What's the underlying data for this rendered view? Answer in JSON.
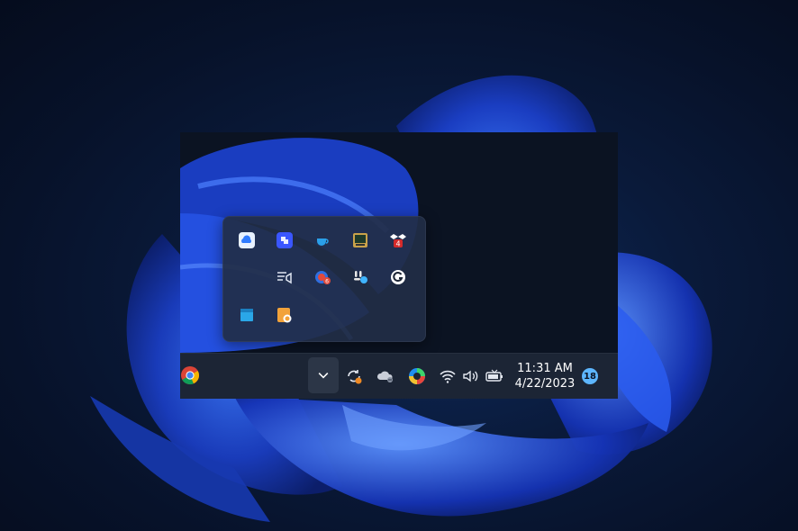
{
  "taskbar": {
    "pinned_app": "chrome-icon",
    "overflow_chevron": "chevron-down-icon",
    "tray_icons": [
      "sync-icon",
      "onedrive-icon",
      "edge-icon",
      "wifi-icon",
      "volume-icon",
      "battery-icon"
    ],
    "clock": {
      "time": "11:31 AM",
      "date": "4/22/2023"
    },
    "notification_count": "18"
  },
  "overflow_panel": {
    "icons": [
      "cloud-drive-icon",
      "app-cube-icon",
      "teacup-icon",
      "display-app-icon",
      "dropbox-icon",
      "media-cast-icon",
      "red-app-icon",
      "slack-icon",
      "grammarly-icon",
      "blue-window-icon",
      "orange-app-icon"
    ],
    "badges": {
      "dropbox": "4",
      "red_app": "6"
    }
  },
  "colors": {
    "accent": "#2f6bff",
    "taskbar_bg": "#1c2535",
    "panel_bg": "#222e46",
    "badge": "#5db6ff"
  }
}
